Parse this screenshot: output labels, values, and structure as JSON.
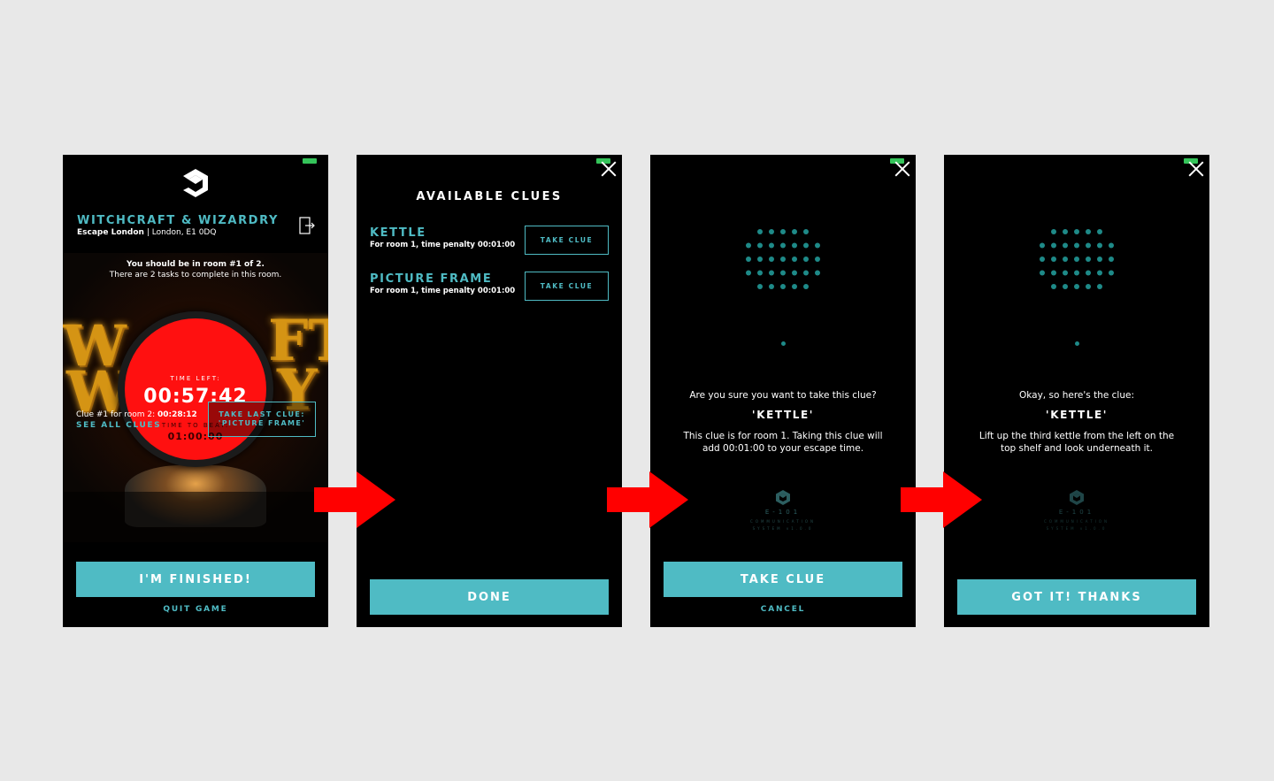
{
  "screen1": {
    "game_title": "WITCHCRAFT & WIZARDRY",
    "venue_name": "Escape London",
    "venue_address": " | London, E1 0DQ",
    "room_line1": "You should be in room #1 of 2.",
    "room_line2": "There are 2 tasks to complete in this room.",
    "time_left_label": "TIME LEFT:",
    "time_left": "00:57:42",
    "time_to_beat_label": "TIME TO BEAT:",
    "time_to_beat": "01:00:00",
    "clue_prefix": "Clue #1 for room 2: ",
    "clue_time": "00:28:12",
    "see_all_clues": "SEE ALL CLUES",
    "take_last_clue_line1": "TAKE LAST CLUE:",
    "take_last_clue_line2": "'PICTURE FRAME'",
    "finished_button": "I'M FINISHED!",
    "quit_game": "QUIT GAME"
  },
  "screen2": {
    "title": "AVAILABLE CLUES",
    "clues": [
      {
        "name": "KETTLE",
        "meta": "For room 1, time penalty 00:01:00",
        "button": "TAKE CLUE"
      },
      {
        "name": "PICTURE FRAME",
        "meta": "For room 1, time penalty 00:01:00",
        "button": "TAKE CLUE"
      }
    ],
    "done_button": "DONE"
  },
  "screen3": {
    "question": "Are you sure you want to take this clue?",
    "clue_name": "'KETTLE'",
    "detail_line1": "This clue is for room 1. Taking this clue will",
    "detail_line2": "add 00:01:00 to your escape time.",
    "brand_name": "E-101",
    "brand_sub1": "COMMUNICATION",
    "brand_sub2": "SYSTEM v1.0.0",
    "take_clue_button": "TAKE CLUE",
    "cancel": "CANCEL"
  },
  "screen4": {
    "intro": "Okay, so here's the clue:",
    "clue_name": "'KETTLE'",
    "clue_line1": "Lift up the third kettle from the left on the",
    "clue_line2": "top shelf and look underneath it.",
    "brand_name": "E-101",
    "brand_sub1": "COMMUNICATION",
    "brand_sub2": "SYSTEM v1.0.0",
    "got_it_button": "GOT IT! THANKS"
  },
  "colors": {
    "accent": "#4fbbc4",
    "timer_red": "#ff1010",
    "arrow_red": "#ff0000",
    "battery_green": "#35c45a",
    "background": "#e8e8e8"
  }
}
